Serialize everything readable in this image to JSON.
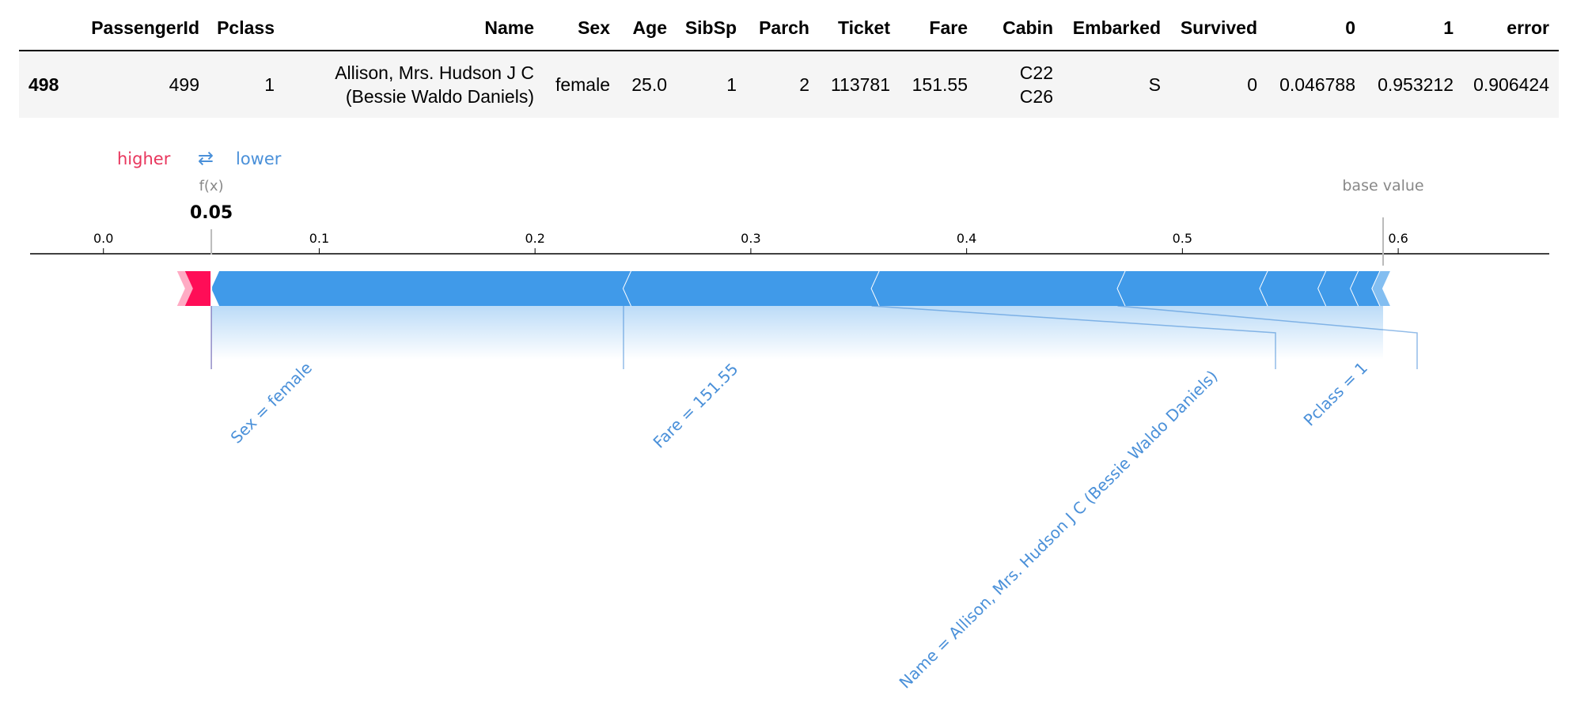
{
  "table": {
    "columns": [
      "",
      "PassengerId",
      "Pclass",
      "Name",
      "Sex",
      "Age",
      "SibSp",
      "Parch",
      "Ticket",
      "Fare",
      "Cabin",
      "Embarked",
      "Survived",
      "0",
      "1",
      "error"
    ],
    "row": {
      "index": "498",
      "PassengerId": "499",
      "Pclass": "1",
      "Name_line1": "Allison, Mrs. Hudson J C",
      "Name_line2": "(Bessie Waldo Daniels)",
      "Sex": "female",
      "Age": "25.0",
      "SibSp": "1",
      "Parch": "2",
      "Ticket": "113781",
      "Fare": "151.55",
      "Cabin_line1": "C22",
      "Cabin_line2": "C26",
      "Embarked": "S",
      "Survived": "0",
      "p0": "0.046788",
      "p1": "0.953212",
      "error": "0.906424"
    }
  },
  "chart_data": {
    "type": "force",
    "legend": {
      "higher": "higher",
      "arrow": "⇄",
      "lower": "lower"
    },
    "output_label": "f(x)",
    "output_value": 0.05,
    "output_text": "0.05",
    "base_label": "base value",
    "base_value": 0.593,
    "xlim": [
      -0.034,
      0.67
    ],
    "ticks": [
      0.0,
      0.1,
      0.2,
      0.3,
      0.4,
      0.5,
      0.6
    ],
    "tick_labels": [
      "0.0",
      "0.1",
      "0.2",
      "0.3",
      "0.4",
      "0.5",
      "0.6"
    ],
    "segments_higher": [
      {
        "from": 0.04,
        "to": 0.05
      }
    ],
    "segments_lower": [
      {
        "from": 0.05,
        "to": 0.241,
        "label": "Sex = female"
      },
      {
        "from": 0.241,
        "to": 0.356,
        "label": "Fare = 151.55"
      },
      {
        "from": 0.356,
        "to": 0.47,
        "label": "Name = Allison, Mrs. Hudson J C (Bessie Waldo Daniels)"
      },
      {
        "from": 0.47,
        "to": 0.536,
        "label": "Pclass = 1"
      },
      {
        "from": 0.536,
        "to": 0.563
      },
      {
        "from": 0.563,
        "to": 0.578
      },
      {
        "from": 0.578,
        "to": 0.588
      },
      {
        "from": 0.588,
        "to": 0.593
      }
    ],
    "colors": {
      "higher": "#ff0d57",
      "lower": "#1e88e5",
      "lower_text": "#4a90d9",
      "higher_text": "#e8365d",
      "gray": "#888888"
    }
  }
}
